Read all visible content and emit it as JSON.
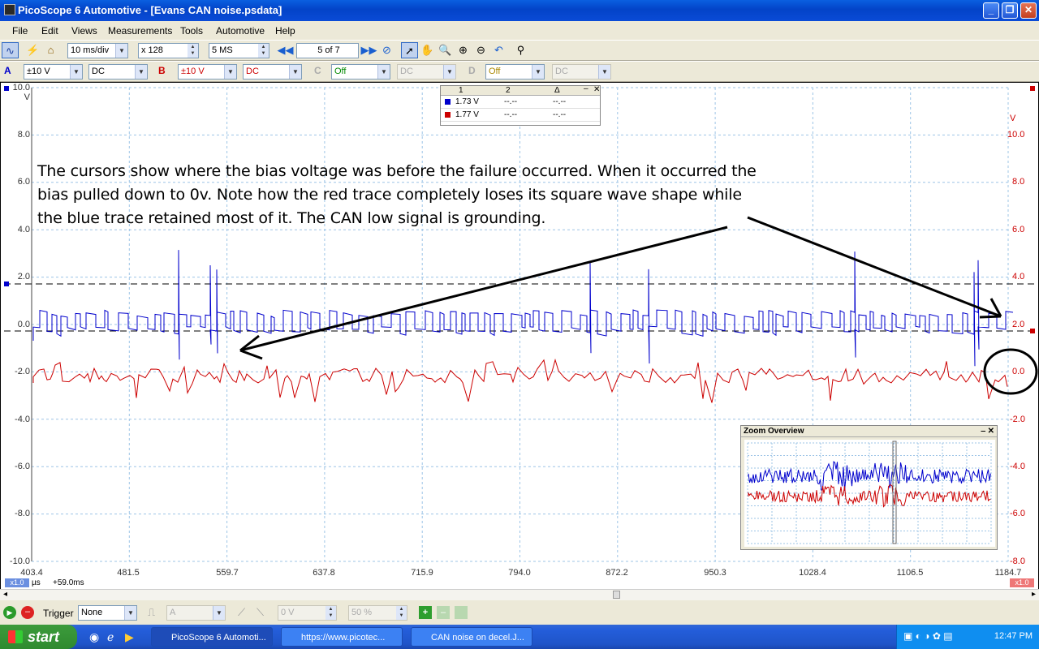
{
  "window": {
    "title": "PicoScope 6 Automotive - [Evans CAN noise.psdata]"
  },
  "menu": [
    "File",
    "Edit",
    "Views",
    "Measurements",
    "Tools",
    "Automotive",
    "Help"
  ],
  "toolbar": {
    "timebase": "10 ms/div",
    "zoom": "x 128",
    "samples": "5 MS",
    "buffer": "5 of 7"
  },
  "channels": {
    "a": {
      "label": "A",
      "range": "±10 V",
      "coupling": "DC"
    },
    "b": {
      "label": "B",
      "range": "±10 V",
      "coupling": "DC"
    },
    "c": {
      "label": "C",
      "range": "Off",
      "coupling": "DC"
    },
    "d": {
      "label": "D",
      "range": "Off",
      "coupling": "DC"
    }
  },
  "axes": {
    "left_unit": "V",
    "right_unit": "V",
    "left_ticks": [
      "10.0",
      "8.0",
      "6.0",
      "4.0",
      "2.0",
      "0.0",
      "-2.0",
      "-4.0",
      "-6.0",
      "-8.0",
      "-10.0"
    ],
    "right_ticks": [
      "10.0",
      "8.0",
      "6.0",
      "4.0",
      "2.0",
      "0.0",
      "-2.0",
      "-4.0",
      "-6.0",
      "-8.0"
    ],
    "x_ticks": [
      "403.4",
      "481.5",
      "559.7",
      "637.8",
      "715.9",
      "794.0",
      "872.2",
      "950.3",
      "1028.4",
      "1106.5",
      "1184.7"
    ],
    "x_unit": "µs",
    "x_offset": "+59.0ms",
    "x_scale_left": "x1.0",
    "x_scale_right": "x1.0"
  },
  "cursor_table": {
    "headers": [
      "1",
      "2",
      "Δ"
    ],
    "rows": [
      {
        "ch": "A",
        "color": "#0000cc",
        "v1": "1.73 V",
        "v2": "--.--",
        "delta": "--.--"
      },
      {
        "ch": "B",
        "color": "#cc0000",
        "v1": "1.77 V",
        "v2": "--.--",
        "delta": "--.--"
      }
    ]
  },
  "annotation": "The cursors show where the bias voltage was before the failure occurred. When it occurred the bias pulled down to 0v. Note how the red trace completely loses its square wave shape while the blue trace retained most of it. The CAN low signal is grounding.",
  "zoom_overview": {
    "title": "Zoom Overview"
  },
  "trigger": {
    "label": "Trigger",
    "mode": "None",
    "source": "A",
    "level": "0 V",
    "position": "50 %"
  },
  "taskbar": {
    "start": "start",
    "tasks": [
      "PicoScope 6 Automoti...",
      "https://www.picotec...",
      "CAN noise on decel.J..."
    ],
    "clock": "12:47 PM"
  },
  "colors": {
    "channel_a": "#0000cc",
    "channel_b": "#cc0000",
    "grid": "#9dc4e6"
  }
}
